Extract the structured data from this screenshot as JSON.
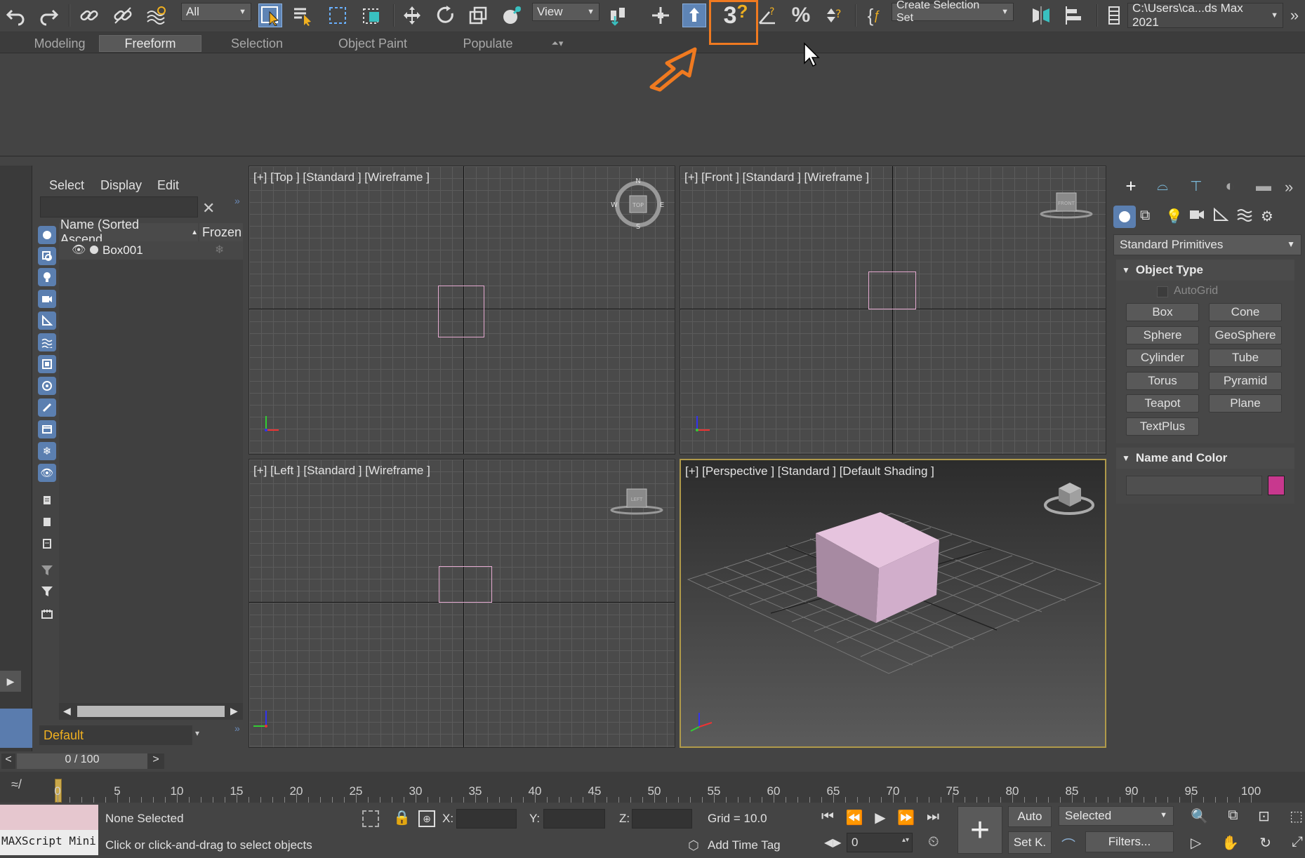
{
  "toolbar": {
    "selection_filter": "All",
    "coord_system": "View",
    "snap_value": "3",
    "named_selection": "Create Selection Set",
    "project_path": "C:\\Users\\ca...ds Max 2021"
  },
  "ribbon": {
    "tabs": [
      {
        "label": "Modeling",
        "active": false
      },
      {
        "label": "Freeform",
        "active": true
      },
      {
        "label": "Selection",
        "active": false
      },
      {
        "label": "Object Paint",
        "active": false
      },
      {
        "label": "Populate",
        "active": false
      }
    ]
  },
  "explorer": {
    "menus": [
      "Select",
      "Display",
      "Edit"
    ],
    "col_name": "Name (Sorted Ascend...",
    "col_frozen": "Frozen",
    "objects": [
      {
        "name": "Box001"
      }
    ],
    "layer": "Default"
  },
  "viewports": {
    "top": {
      "label": "[+] [Top ] [Standard ] [Wireframe ]",
      "gizmo": "TOP",
      "compass": [
        "N",
        "E",
        "S",
        "W"
      ]
    },
    "front": {
      "label": "[+] [Front ] [Standard ] [Wireframe ]",
      "gizmo": "FRONT"
    },
    "left": {
      "label": "[+] [Left ] [Standard ] [Wireframe ]",
      "gizmo": "LEFT"
    },
    "perspective": {
      "label": "[+] [Perspective ] [Standard ] [Default Shading ]"
    }
  },
  "command_panel": {
    "category": "Standard Primitives",
    "rollout_object_type": "Object Type",
    "autogrid": "AutoGrid",
    "buttons": [
      "Box",
      "Cone",
      "Sphere",
      "GeoSphere",
      "Cylinder",
      "Tube",
      "Torus",
      "Pyramid",
      "Teapot",
      "Plane",
      "TextPlus"
    ],
    "rollout_name_color": "Name and Color",
    "object_color": "#c8388e"
  },
  "timeline": {
    "frame_display": "0 / 100",
    "ticks": [
      "0",
      "5",
      "10",
      "15",
      "20",
      "25",
      "30",
      "35",
      "40",
      "45",
      "50",
      "55",
      "60",
      "65",
      "70",
      "75",
      "80",
      "85",
      "90",
      "95",
      "100"
    ]
  },
  "status": {
    "maxscript": "MAXScript Mini",
    "selection": "None Selected",
    "prompt": "Click or click-and-drag to select objects",
    "x_label": "X:",
    "y_label": "Y:",
    "z_label": "Z:",
    "grid": "Grid = 10.0",
    "add_time_tag": "Add Time Tag",
    "auto_key": "Auto",
    "set_key": "Set K.",
    "key_filter_set": "Selected",
    "filters": "Filters...",
    "current_frame": "0"
  },
  "colors": {
    "accent_callout": "#f07a20",
    "wireframe": "#e4a9d0",
    "box_top": "#e4c3dc"
  }
}
